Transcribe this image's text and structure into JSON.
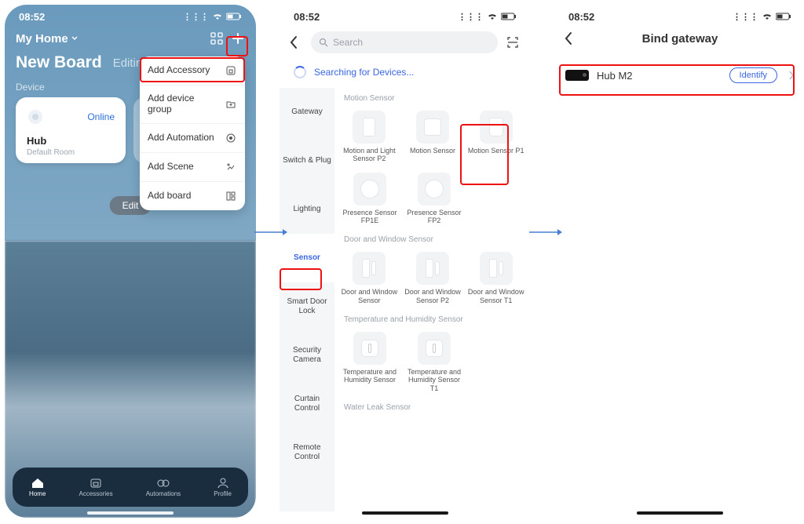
{
  "status_time": "08:52",
  "screen1": {
    "home_label": "My Home",
    "board_title": "New Board",
    "editing_text": "Editing O",
    "device_section": "Device",
    "card": {
      "status": "Online",
      "name": "Hub",
      "room": "Default Room"
    },
    "edit_btn": "Edit",
    "menu": [
      {
        "label": "Add Accessory"
      },
      {
        "label": "Add device group"
      },
      {
        "label": "Add Automation"
      },
      {
        "label": "Add Scene"
      },
      {
        "label": "Add board"
      }
    ],
    "tabs": [
      "Home",
      "Accessories",
      "Automations",
      "Profile"
    ]
  },
  "screen2": {
    "search_placeholder": "Search",
    "searching_text": "Searching for Devices...",
    "sidebar": [
      "Gateway",
      "Switch & Plug",
      "Lighting",
      "Sensor",
      "Smart Door Lock",
      "Security Camera",
      "Curtain Control",
      "Remote Control"
    ],
    "sidebar_active": "Sensor",
    "sections": [
      {
        "title": "Motion Sensor",
        "items": [
          "Motion and Light Sensor P2",
          "Motion Sensor",
          "Motion Sensor P1"
        ]
      },
      {
        "title": "",
        "items": [
          "Presence Sensor FP1E",
          "Presence Sensor FP2"
        ]
      },
      {
        "title": "Door and Window Sensor",
        "items": [
          "Door and Window Sensor",
          "Door and Window Sensor P2",
          "Door and Window Sensor T1"
        ]
      },
      {
        "title": "Temperature and Humidity Sensor",
        "items": [
          "Temperature and Humidity Sensor",
          "Temperature and Humidity Sensor T1"
        ]
      },
      {
        "title": "Water Leak Sensor",
        "items": []
      }
    ]
  },
  "screen3": {
    "title": "Bind gateway",
    "hub_name": "Hub M2",
    "identify_label": "Identify"
  }
}
